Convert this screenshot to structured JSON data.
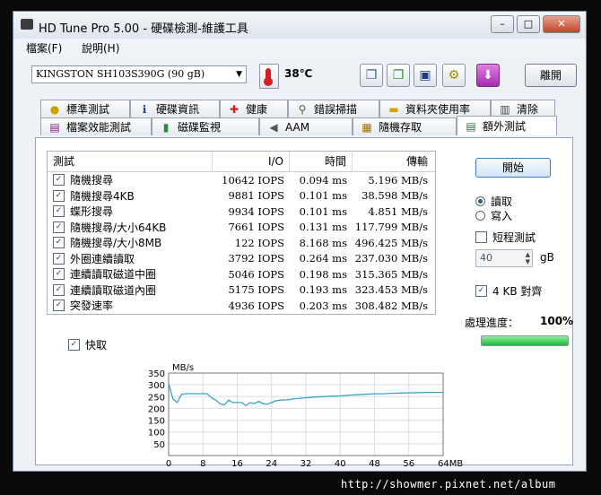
{
  "window": {
    "title": "HD Tune Pro  5.00 - 硬碟檢測-維護工具",
    "minimize": "–",
    "maximize": "□",
    "close": "✕"
  },
  "menu": {
    "file": "檔案(F)",
    "help": "說明(H)"
  },
  "toolbar": {
    "drive": "KINGSTON SH103S390G     (90 gB)",
    "temperature": "38℃",
    "exit_label": "離開"
  },
  "tabs_row1": [
    {
      "label": "標準測試",
      "icon": "bulb-icon"
    },
    {
      "label": "硬碟資訊",
      "icon": "info-icon"
    },
    {
      "label": "健康",
      "icon": "health-cross-icon"
    },
    {
      "label": "錯誤掃描",
      "icon": "magnifier-icon"
    },
    {
      "label": "資料夾使用率",
      "icon": "folder-icon"
    },
    {
      "label": "清除",
      "icon": "trash-icon"
    }
  ],
  "tabs_row2": [
    {
      "label": "檔案效能測試",
      "icon": "file-benchmark-icon"
    },
    {
      "label": "磁碟監視",
      "icon": "bars-icon"
    },
    {
      "label": "AAM",
      "icon": "speaker-icon"
    },
    {
      "label": "隨機存取",
      "icon": "random-access-icon"
    },
    {
      "label": "額外測試",
      "icon": "extra-tests-icon",
      "active": true
    }
  ],
  "results": {
    "headers": {
      "test": "測試",
      "io": "I/O",
      "time": "時間",
      "rate": "傳輸"
    },
    "rows": [
      {
        "name": "隨機搜尋",
        "io": "10642 IOPS",
        "time": "0.094 ms",
        "rate": "5.196 MB/s"
      },
      {
        "name": "隨機搜尋4KB",
        "io": "9881 IOPS",
        "time": "0.101 ms",
        "rate": "38.598 MB/s"
      },
      {
        "name": "蝶形搜尋",
        "io": "9934 IOPS",
        "time": "0.101 ms",
        "rate": "4.851 MB/s"
      },
      {
        "name": "隨機搜尋/大小64KB",
        "io": "7661 IOPS",
        "time": "0.131 ms",
        "rate": "117.799 MB/s"
      },
      {
        "name": "隨機搜尋/大小8MB",
        "io": "122 IOPS",
        "time": "8.168 ms",
        "rate": "496.425 MB/s"
      },
      {
        "name": "外圈連續讀取",
        "io": "3792 IOPS",
        "time": "0.264 ms",
        "rate": "237.030 MB/s"
      },
      {
        "name": "連續讀取磁道中圈",
        "io": "5046 IOPS",
        "time": "0.198 ms",
        "rate": "315.365 MB/s"
      },
      {
        "name": "連續讀取磁道內圈",
        "io": "5175 IOPS",
        "time": "0.193 ms",
        "rate": "323.453 MB/s"
      },
      {
        "name": "突發速率",
        "io": "4936 IOPS",
        "time": "0.203 ms",
        "rate": "308.482 MB/s"
      }
    ]
  },
  "side": {
    "start_label": "開始",
    "read_label": "讀取",
    "write_label": "寫入",
    "short_test_label": "短程測試",
    "short_test_value": "40",
    "unit": "gB",
    "align_label": "4 KB 對齊",
    "progress_label": "處理進度：",
    "progress_value": "100%",
    "progress_fraction": 1.0
  },
  "cache_label": "快取",
  "chart_data": {
    "type": "line",
    "ylabel": "MB/s",
    "xlabel": "",
    "x_ticks": [
      "0",
      "8",
      "16",
      "24",
      "32",
      "40",
      "48",
      "56",
      "64MB"
    ],
    "y_ticks": [
      "350",
      "300",
      "250",
      "200",
      "150",
      "100",
      "50"
    ],
    "xlim": [
      0,
      64
    ],
    "ylim": [
      0,
      350
    ],
    "color": "#3aa3c9",
    "x": [
      0,
      1,
      2,
      3,
      4,
      5,
      6,
      7,
      8,
      9,
      10,
      11,
      12,
      13,
      14,
      15,
      16,
      17,
      18,
      19,
      20,
      21,
      22,
      23,
      24,
      25,
      26,
      27,
      28,
      29,
      30,
      32,
      34,
      36,
      38,
      40,
      42,
      44,
      46,
      48,
      50,
      52,
      54,
      56,
      58,
      60,
      62,
      64
    ],
    "y": [
      305,
      240,
      225,
      260,
      262,
      263,
      262,
      262,
      263,
      262,
      245,
      235,
      220,
      215,
      235,
      225,
      225,
      225,
      212,
      225,
      220,
      230,
      220,
      218,
      225,
      232,
      235,
      236,
      237,
      240,
      242,
      245,
      248,
      250,
      252,
      253,
      256,
      258,
      260,
      262,
      262,
      264,
      265,
      266,
      267,
      268,
      268,
      268
    ]
  },
  "footer_url": "http://showmer.pixnet.net/album"
}
